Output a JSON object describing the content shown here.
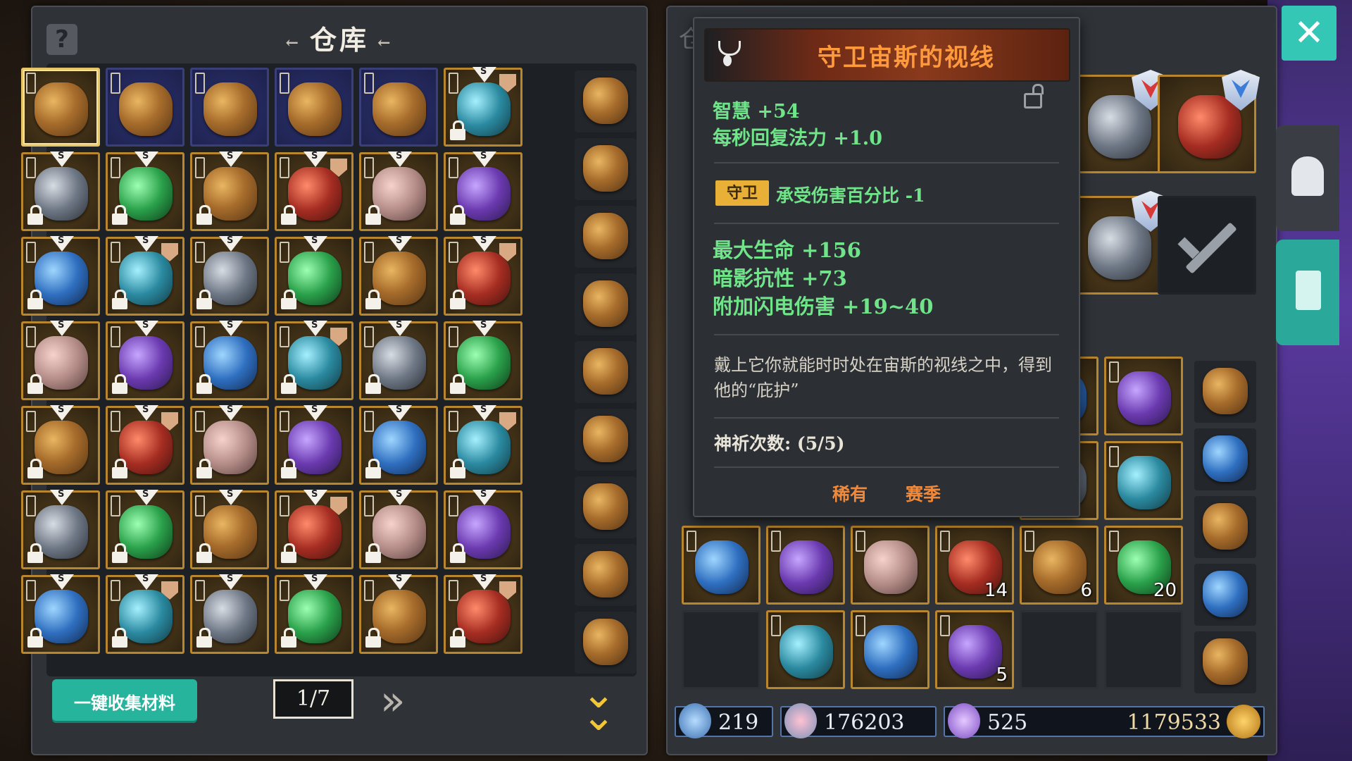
{
  "warehouse": {
    "title": "仓库",
    "title_deco_left": "←",
    "title_deco_right": "←",
    "help_label": "?",
    "collect_button": "一键收集材料",
    "page_indicator": "1/7",
    "next_label": "»",
    "scroll_down_label": "⌄"
  },
  "inventory": {
    "title_fragment": "仓",
    "slot_counts": {
      "c4": "14",
      "c5": "6",
      "c6": "20",
      "c10": "5"
    }
  },
  "currency": {
    "gems": "219",
    "hearts": "176203",
    "crystals": "525",
    "gold": "1179533"
  },
  "tooltip": {
    "name": "守卫宙斯的视线",
    "stat1": "智慧 +54",
    "stat2": "每秒回复法力 +1.0",
    "guard_tag": "守卫",
    "guard_stat": "承受伤害百分比 -1",
    "stat3": "最大生命 +156",
    "stat4": "暗影抗性 +73",
    "stat5": "附加闪电伤害 +19~40",
    "flavor": "戴上它你就能时时处在宙斯的视线之中，得到他的“庇护”",
    "pray": "神祈次数: (5/5)",
    "rarity1": "稀有",
    "rarity2": "赛季"
  },
  "colors": {
    "accent_teal": "#35c7b5",
    "legendary_orange": "#ff9a3c",
    "stat_green": "#6fe489",
    "slot_gold": "#b8862c"
  },
  "icons": {
    "help": "question-icon",
    "lock": "lock-icon",
    "close": "close-icon",
    "helmet": "helmet-icon",
    "book": "codex-icon",
    "sword": "sword-icon",
    "amulet": "amulet-icon"
  }
}
